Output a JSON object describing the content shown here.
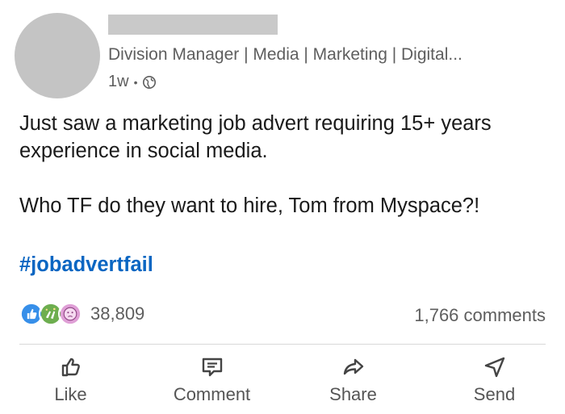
{
  "post": {
    "author_headline": "Division Manager | Media | Marketing | Digital...",
    "time_ago": "1w",
    "meta_separator": "•",
    "paragraph_1": "Just saw a marketing job advert requiring 15+ years experience in social media.",
    "paragraph_2": "Who TF do they want to hire, Tom from Myspace?!",
    "hashtag": "#jobadvertfail"
  },
  "engagement": {
    "reaction_icons": [
      "like-icon",
      "celebrate-icon",
      "curious-icon"
    ],
    "reaction_count": "38,809",
    "comments_count": "1,766 comments"
  },
  "actions": {
    "like_label": "Like",
    "comment_label": "Comment",
    "share_label": "Share",
    "send_label": "Send"
  },
  "colors": {
    "hashtag": "#0a66c2",
    "like_reaction": "#378fe9",
    "celebrate_reaction": "#6dae4f",
    "curious_reaction": "#df9fd6",
    "redaction": "#c4c4c4"
  }
}
